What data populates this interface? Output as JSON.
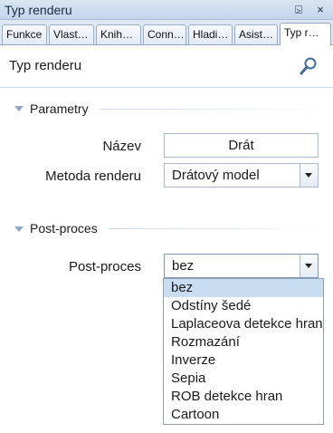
{
  "window": {
    "title": "Typ renderu",
    "pin_glyph": "⍄",
    "close_glyph": "×"
  },
  "tabs": [
    "Funkce",
    "Vlast…",
    "Knih…",
    "Conn…",
    "Hladi…",
    "Asist…",
    "Typ r…"
  ],
  "active_tab": 6,
  "panel": {
    "title": "Typ renderu",
    "search_icon": "search-icon"
  },
  "sections": {
    "parametry": {
      "title": "Parametry",
      "name_label": "Název",
      "name_value": "Drát",
      "render_method_label": "Metoda renderu",
      "render_method_value": "Drátový model"
    },
    "post_proces": {
      "title": "Post-proces",
      "label": "Post-proces",
      "value": "bez",
      "options": [
        "bez",
        "Odstíny šedé",
        "Laplaceova detekce hran",
        "Rozmazání",
        "Inverze",
        "Sepia",
        "ROB detekce hran",
        "Cartoon"
      ],
      "selected_index": 0
    }
  }
}
